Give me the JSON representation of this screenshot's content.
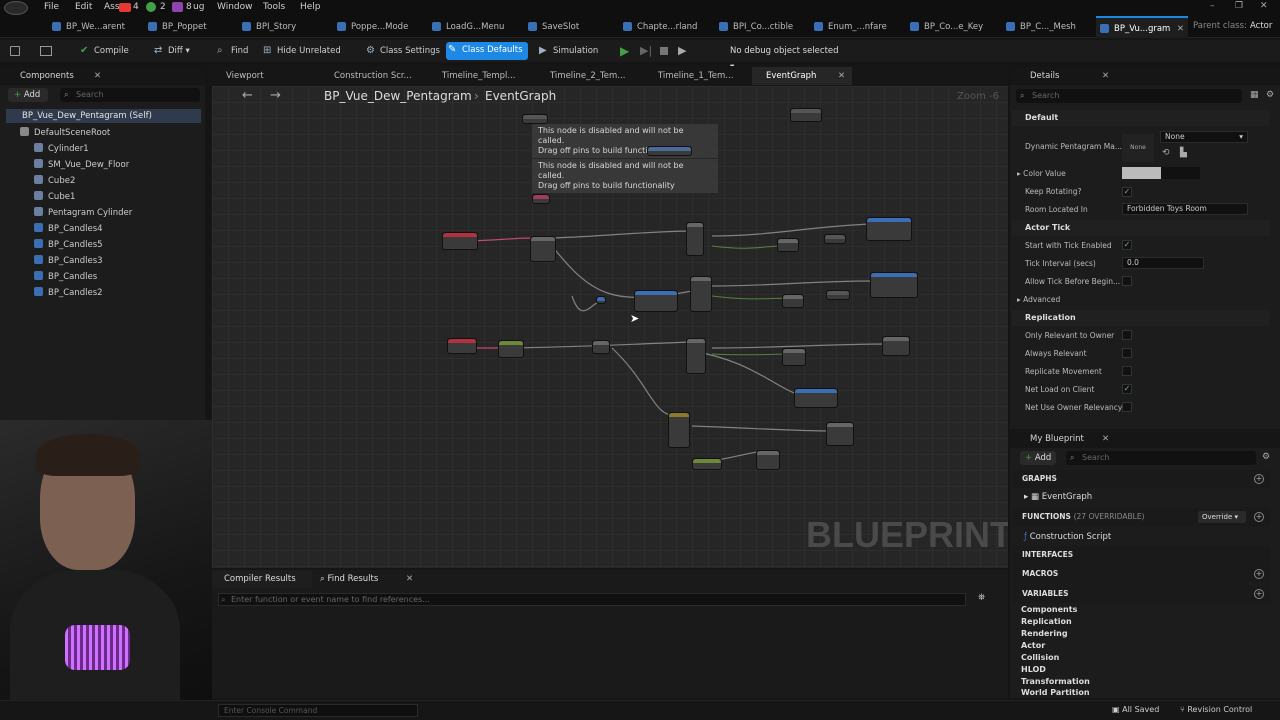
{
  "menu": {
    "items": [
      "File",
      "Edit",
      "Ass",
      "Window",
      "Tools",
      "Help"
    ],
    "notif": [
      "4",
      "2",
      "8"
    ],
    "notif_labels": [
      "",
      "",
      "ug"
    ]
  },
  "doc_tabs": [
    "BP_We...arent",
    "BP_Poppet",
    "BPI_Story",
    "Poppe...Mode",
    "LoadG...Menu",
    "SaveSlot",
    "Chapte...rland",
    "BPI_Co...ctible",
    "Enum_...nfare",
    "BP_Co...e_Key",
    "BP_C..._Mesh",
    "BP_Vu...gram"
  ],
  "parent_class": {
    "label": "Parent class:",
    "value": "Actor"
  },
  "toolbar": {
    "compile": "Compile",
    "diff": "Diff",
    "find": "Find",
    "hide_unrelated": "Hide Unrelated",
    "class_settings": "Class Settings",
    "class_defaults": "Class Defaults",
    "simulation": "Simulation",
    "debug_object": "No debug object selected"
  },
  "components": {
    "title": "Components",
    "add": "Add",
    "search_placeholder": "Search",
    "self": "BP_Vue_Dew_Pentagram (Self)",
    "root": "DefaultSceneRoot",
    "items": [
      "Cylinder1",
      "SM_Vue_Dew_Floor",
      "Cube2",
      "Cube1",
      "Pentagram Cylinder",
      "BP_Candles4",
      "BP_Candles5",
      "BP_Candles3",
      "BP_Candles",
      "BP_Candles2"
    ]
  },
  "graph_tabs": [
    "Viewport",
    "Construction Scr...",
    "Timeline_Templ...",
    "Timeline_2_Tem...",
    "Timeline_1_Tem...",
    "EventGraph"
  ],
  "breadcrumb": {
    "blueprint": "BP_Vue_Dew_Pentagram",
    "graph": "EventGraph",
    "zoom": "Zoom -6"
  },
  "graph": {
    "note": "This node is disabled and will not be called.\nDrag off pins to build functionality",
    "watermark": "BLUEPRINT"
  },
  "bottom": {
    "tab1": "Compiler Results",
    "tab2": "Find Results",
    "find_placeholder": "Enter function or event name to find references...",
    "console_placeholder": "Enter Console Command"
  },
  "details": {
    "title": "Details",
    "search_placeholder": "Search",
    "sections": {
      "default": "Default",
      "actor_tick": "Actor Tick",
      "advanced": "Advanced",
      "replication": "Replication"
    },
    "rows": {
      "dpm": "Dynamic Pentagram Ma...",
      "dpm_value": "None",
      "dpm_thumb": "None",
      "color": "Color Value",
      "keep": "Keep Rotating?",
      "room": "Room Located In",
      "room_value": "Forbidden Toys Room",
      "start_tick": "Start with Tick Enabled",
      "tick_interval": "Tick Interval (secs)",
      "tick_value": "0.0",
      "allow_tick": "Allow Tick Before Begin...",
      "only_rel": "Only Relevant to Owner",
      "always_rel": "Always Relevant",
      "rep_move": "Replicate Movement",
      "net_load": "Net Load on Client",
      "net_use": "Net Use Owner Relevancy"
    }
  },
  "my_blueprint": {
    "title": "My Blueprint",
    "add": "Add",
    "search_placeholder": "Search",
    "graphs": "GRAPHS",
    "event_graph": "EventGraph",
    "functions": "FUNCTIONS",
    "functions_count": "(27 OVERRIDABLE)",
    "override": "Override",
    "construction": "Construction Script",
    "interfaces": "INTERFACES",
    "macros": "MACROS",
    "variables": "VARIABLES",
    "var_cats": [
      "Components",
      "Replication",
      "Rendering",
      "Actor",
      "Collision",
      "HLOD",
      "Transformation",
      "World Partition"
    ]
  },
  "status": {
    "saved": "All Saved",
    "revision": "Revision Control"
  }
}
